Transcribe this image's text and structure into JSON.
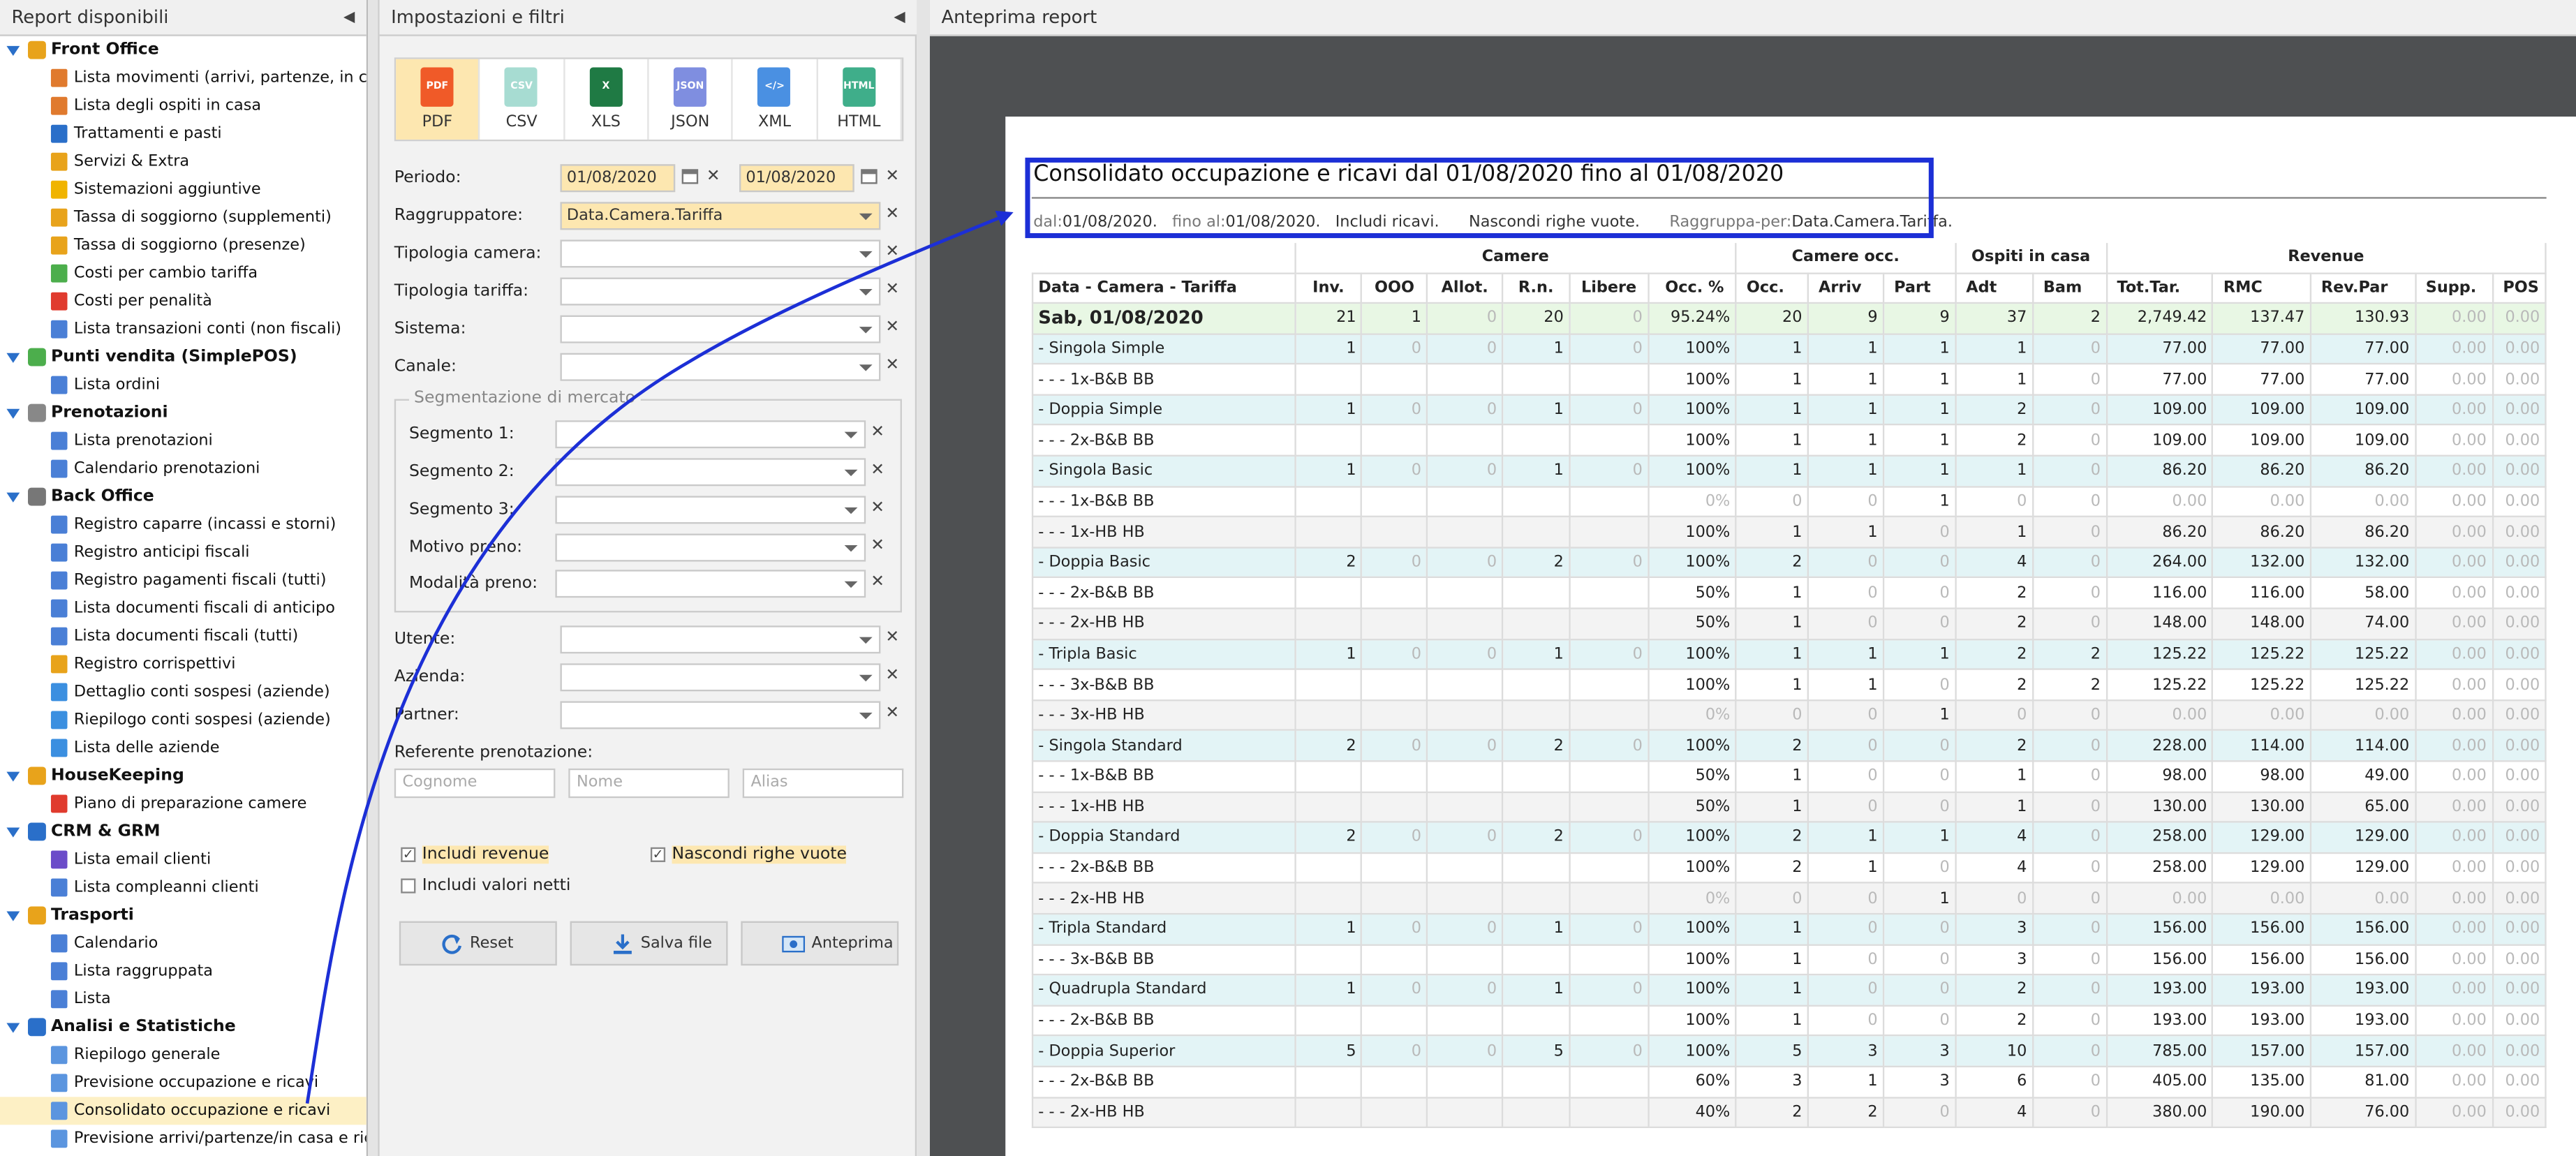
{
  "left_panel": {
    "title": "Report disponibili",
    "groups": [
      {
        "label": "Front Office",
        "icon": "front-office-icon",
        "items": [
          {
            "label": "Lista movimenti (arrivi, partenze, in casa)",
            "icon": "bed-icon"
          },
          {
            "label": "Lista degli ospiti in casa",
            "icon": "bed-icon"
          },
          {
            "label": "Trattamenti e pasti",
            "icon": "cutlery-icon"
          },
          {
            "label": "Servizi & Extra",
            "icon": "services-icon"
          },
          {
            "label": "Sistemazioni aggiuntive",
            "icon": "star-icon"
          },
          {
            "label": "Tassa di soggiorno (supplementi)",
            "icon": "hand-money-icon"
          },
          {
            "label": "Tassa di soggiorno (presenze)",
            "icon": "hand-money-icon"
          },
          {
            "label": "Costi per cambio tariffa",
            "icon": "tag-icon"
          },
          {
            "label": "Costi per penalità",
            "icon": "alert-icon"
          },
          {
            "label": "Lista transazioni conti (non fiscali)",
            "icon": "list-icon"
          }
        ]
      },
      {
        "label": "Punti vendita (SimplePOS)",
        "icon": "store-icon",
        "items": [
          {
            "label": "Lista ordini",
            "icon": "list-icon"
          }
        ]
      },
      {
        "label": "Prenotazioni",
        "icon": "bell-icon",
        "items": [
          {
            "label": "Lista prenotazioni",
            "icon": "list-icon"
          },
          {
            "label": "Calendario prenotazioni",
            "icon": "calendar-icon"
          }
        ]
      },
      {
        "label": "Back Office",
        "icon": "back-office-icon",
        "items": [
          {
            "label": "Registro caparre (incassi e storni)",
            "icon": "list-icon"
          },
          {
            "label": "Registro anticipi fiscali",
            "icon": "list-icon"
          },
          {
            "label": "Registro pagamenti fiscali (tutti)",
            "icon": "list-icon"
          },
          {
            "label": "Lista documenti fiscali di anticipo",
            "icon": "list-icon"
          },
          {
            "label": "Lista documenti fiscali (tutti)",
            "icon": "list-icon"
          },
          {
            "label": "Registro corrispettivi",
            "icon": "hand-money-icon"
          },
          {
            "label": "Dettaglio conti sospesi (aziende)",
            "icon": "building-icon"
          },
          {
            "label": "Riepilogo conti sospesi (aziende)",
            "icon": "building-icon"
          },
          {
            "label": "Lista delle aziende",
            "icon": "building-icon"
          }
        ]
      },
      {
        "label": "HouseKeeping",
        "icon": "broom-icon",
        "items": [
          {
            "label": "Piano di preparazione camere",
            "icon": "door-icon"
          }
        ]
      },
      {
        "label": "CRM & GRM",
        "icon": "crm-icon",
        "items": [
          {
            "label": "Lista email clienti",
            "icon": "email-icon"
          },
          {
            "label": "Lista compleanni clienti",
            "icon": "list-icon"
          }
        ]
      },
      {
        "label": "Trasporti",
        "icon": "car-icon",
        "items": [
          {
            "label": "Calendario",
            "icon": "calendar-icon"
          },
          {
            "label": "Lista raggruppata",
            "icon": "list-icon"
          },
          {
            "label": "Lista",
            "icon": "list-icon"
          }
        ]
      },
      {
        "label": "Analisi e Statistiche",
        "icon": "chart-icon",
        "items": [
          {
            "label": "Riepilogo generale",
            "icon": "document-icon"
          },
          {
            "label": "Previsione occupazione e ricavi",
            "icon": "document-icon"
          },
          {
            "label": "Consolidato occupazione e ricavi",
            "icon": "document-icon",
            "selected": true
          },
          {
            "label": "Previsione arrivi/partenze/in casa e ricavi",
            "icon": "document-icon"
          }
        ]
      }
    ]
  },
  "mid_panel": {
    "title": "Impostazioni e filtri",
    "export": [
      {
        "label": "PDF",
        "icon": "pdf-icon",
        "active": true,
        "badge": "PDF",
        "color": "#f05a28"
      },
      {
        "label": "CSV",
        "icon": "csv-icon",
        "active": false,
        "badge": "CSV",
        "color": "#a7dcd2"
      },
      {
        "label": "XLS",
        "icon": "xls-icon",
        "active": false,
        "badge": "X",
        "color": "#1f7a44"
      },
      {
        "label": "JSON",
        "icon": "json-icon",
        "active": false,
        "badge": "JSON",
        "color": "#7f8ee0"
      },
      {
        "label": "XML",
        "icon": "xml-icon",
        "active": false,
        "badge": "</>",
        "color": "#4a90e2"
      },
      {
        "label": "HTML",
        "icon": "html-icon",
        "active": false,
        "badge": "HTML",
        "color": "#3fae8a"
      }
    ],
    "periodo": {
      "label": "Periodo:",
      "from": "01/08/2020",
      "to": "01/08/2020"
    },
    "raggruppatore": {
      "label": "Raggruppatore:",
      "value": "Data.Camera.Tariffa"
    },
    "tipologia_camera": {
      "label": "Tipologia camera:"
    },
    "tipologia_tariffa": {
      "label": "Tipologia tariffa:"
    },
    "sistema": {
      "label": "Sistema:"
    },
    "canale": {
      "label": "Canale:"
    },
    "segmentazione": {
      "legend": "Segmentazione di mercato",
      "segmento1": "Segmento 1:",
      "segmento2": "Segmento 2:",
      "segmento3": "Segmento 3:",
      "motivo": "Motivo preno:",
      "modalita": "Modalità preno:"
    },
    "utente": {
      "label": "Utente:"
    },
    "azienda": {
      "label": "Azienda:"
    },
    "partner": {
      "label": "Partner:"
    },
    "referente": {
      "label": "Referente prenotazione:",
      "cognome_ph": "Cognome",
      "nome_ph": "Nome",
      "alias_ph": "Alias"
    },
    "includi_revenue": "Includi revenue",
    "nascondi_righe": "Nascondi righe vuote",
    "includi_netti": "Includi valori netti",
    "reset": "Reset",
    "salva": "Salva file",
    "anteprima": "Anteprima"
  },
  "right_panel": {
    "title": "Anteprima report",
    "report": {
      "title": "Consolidato occupazione e ricavi dal 01/08/2020 fino al 01/08/2020",
      "summary": {
        "dal_k": "dal:",
        "dal_v": "01/08/2020.",
        "fino_k": "fino al:",
        "fino_v": "01/08/2020.",
        "includi": "Includi ricavi.",
        "nascondi": "Nascondi righe vuote.",
        "ragg_k": "Raggruppa-per:",
        "ragg_v": "Data.Camera.Tariffa."
      },
      "group_headers": {
        "camere": "Camere",
        "camere_occ": "Camere occ.",
        "ospiti": "Ospiti in casa",
        "revenue": "Revenue"
      },
      "columns": [
        "Data - Camera - Tariffa",
        "Inv.",
        "OOO",
        "Allot.",
        "R.n.",
        "Libere",
        "Occ. %",
        "Occ.",
        "Arriv",
        "Part",
        "Adt",
        "Bam",
        "Tot.Tar.",
        "RMC",
        "Rev.Par",
        "Supp.",
        "POS"
      ],
      "rows": [
        {
          "t": "day",
          "c": [
            "Sab, 01/08/2020",
            "21",
            "1",
            "0",
            "20",
            "0",
            "95.24%",
            "20",
            "9",
            "9",
            "37",
            "2",
            "2,749.42",
            "137.47",
            "130.93",
            "0.00",
            "0.00"
          ]
        },
        {
          "t": "room",
          "c": [
            "- Singola Simple",
            "1",
            "0",
            "0",
            "1",
            "0",
            "100%",
            "1",
            "1",
            "1",
            "1",
            "0",
            "77.00",
            "77.00",
            "77.00",
            "0.00",
            "0.00"
          ]
        },
        {
          "t": "sub",
          "c": [
            "- - - 1x-B&B BB",
            "",
            "",
            "",
            "",
            "",
            "100%",
            "1",
            "1",
            "1",
            "1",
            "0",
            "77.00",
            "77.00",
            "77.00",
            "0.00",
            "0.00"
          ]
        },
        {
          "t": "room",
          "c": [
            "- Doppia Simple",
            "1",
            "0",
            "0",
            "1",
            "0",
            "100%",
            "1",
            "1",
            "1",
            "2",
            "0",
            "109.00",
            "109.00",
            "109.00",
            "0.00",
            "0.00"
          ]
        },
        {
          "t": "sub",
          "c": [
            "- - - 2x-B&B BB",
            "",
            "",
            "",
            "",
            "",
            "100%",
            "1",
            "1",
            "1",
            "2",
            "0",
            "109.00",
            "109.00",
            "109.00",
            "0.00",
            "0.00"
          ]
        },
        {
          "t": "room",
          "c": [
            "- Singola Basic",
            "1",
            "0",
            "0",
            "1",
            "0",
            "100%",
            "1",
            "1",
            "1",
            "1",
            "0",
            "86.20",
            "86.20",
            "86.20",
            "0.00",
            "0.00"
          ]
        },
        {
          "t": "sub",
          "c": [
            "- - - 1x-B&B BB",
            "",
            "",
            "",
            "",
            "",
            "0%",
            "0",
            "0",
            "1",
            "0",
            "0",
            "0.00",
            "0.00",
            "0.00",
            "0.00",
            "0.00"
          ]
        },
        {
          "t": "sub",
          "c": [
            "- - - 1x-HB HB",
            "",
            "",
            "",
            "",
            "",
            "100%",
            "1",
            "1",
            "0",
            "1",
            "0",
            "86.20",
            "86.20",
            "86.20",
            "0.00",
            "0.00"
          ]
        },
        {
          "t": "room",
          "c": [
            "- Doppia Basic",
            "2",
            "0",
            "0",
            "2",
            "0",
            "100%",
            "2",
            "0",
            "0",
            "4",
            "0",
            "264.00",
            "132.00",
            "132.00",
            "0.00",
            "0.00"
          ]
        },
        {
          "t": "sub",
          "c": [
            "- - - 2x-B&B BB",
            "",
            "",
            "",
            "",
            "",
            "50%",
            "1",
            "0",
            "0",
            "2",
            "0",
            "116.00",
            "116.00",
            "58.00",
            "0.00",
            "0.00"
          ]
        },
        {
          "t": "sub",
          "c": [
            "- - - 2x-HB HB",
            "",
            "",
            "",
            "",
            "",
            "50%",
            "1",
            "0",
            "0",
            "2",
            "0",
            "148.00",
            "148.00",
            "74.00",
            "0.00",
            "0.00"
          ]
        },
        {
          "t": "room",
          "c": [
            "- Tripla Basic",
            "1",
            "0",
            "0",
            "1",
            "0",
            "100%",
            "1",
            "1",
            "1",
            "2",
            "2",
            "125.22",
            "125.22",
            "125.22",
            "0.00",
            "0.00"
          ]
        },
        {
          "t": "sub",
          "c": [
            "- - - 3x-B&B BB",
            "",
            "",
            "",
            "",
            "",
            "100%",
            "1",
            "1",
            "0",
            "2",
            "2",
            "125.22",
            "125.22",
            "125.22",
            "0.00",
            "0.00"
          ]
        },
        {
          "t": "sub",
          "c": [
            "- - - 3x-HB HB",
            "",
            "",
            "",
            "",
            "",
            "0%",
            "0",
            "0",
            "1",
            "0",
            "0",
            "0.00",
            "0.00",
            "0.00",
            "0.00",
            "0.00"
          ]
        },
        {
          "t": "room",
          "c": [
            "- Singola Standard",
            "2",
            "0",
            "0",
            "2",
            "0",
            "100%",
            "2",
            "0",
            "0",
            "2",
            "0",
            "228.00",
            "114.00",
            "114.00",
            "0.00",
            "0.00"
          ]
        },
        {
          "t": "sub",
          "c": [
            "- - - 1x-B&B BB",
            "",
            "",
            "",
            "",
            "",
            "50%",
            "1",
            "0",
            "0",
            "1",
            "0",
            "98.00",
            "98.00",
            "49.00",
            "0.00",
            "0.00"
          ]
        },
        {
          "t": "sub",
          "c": [
            "- - - 1x-HB HB",
            "",
            "",
            "",
            "",
            "",
            "50%",
            "1",
            "0",
            "0",
            "1",
            "0",
            "130.00",
            "130.00",
            "65.00",
            "0.00",
            "0.00"
          ]
        },
        {
          "t": "room",
          "c": [
            "- Doppia Standard",
            "2",
            "0",
            "0",
            "2",
            "0",
            "100%",
            "2",
            "1",
            "1",
            "4",
            "0",
            "258.00",
            "129.00",
            "129.00",
            "0.00",
            "0.00"
          ]
        },
        {
          "t": "sub",
          "c": [
            "- - - 2x-B&B BB",
            "",
            "",
            "",
            "",
            "",
            "100%",
            "2",
            "1",
            "0",
            "4",
            "0",
            "258.00",
            "129.00",
            "129.00",
            "0.00",
            "0.00"
          ]
        },
        {
          "t": "sub",
          "c": [
            "- - - 2x-HB HB",
            "",
            "",
            "",
            "",
            "",
            "0%",
            "0",
            "0",
            "1",
            "0",
            "0",
            "0.00",
            "0.00",
            "0.00",
            "0.00",
            "0.00"
          ]
        },
        {
          "t": "room",
          "c": [
            "- Tripla Standard",
            "1",
            "0",
            "0",
            "1",
            "0",
            "100%",
            "1",
            "0",
            "0",
            "3",
            "0",
            "156.00",
            "156.00",
            "156.00",
            "0.00",
            "0.00"
          ]
        },
        {
          "t": "sub",
          "c": [
            "- - - 3x-B&B BB",
            "",
            "",
            "",
            "",
            "",
            "100%",
            "1",
            "0",
            "0",
            "3",
            "0",
            "156.00",
            "156.00",
            "156.00",
            "0.00",
            "0.00"
          ]
        },
        {
          "t": "room",
          "c": [
            "- Quadrupla Standard",
            "1",
            "0",
            "0",
            "1",
            "0",
            "100%",
            "1",
            "0",
            "0",
            "2",
            "0",
            "193.00",
            "193.00",
            "193.00",
            "0.00",
            "0.00"
          ]
        },
        {
          "t": "sub",
          "c": [
            "- - - 2x-B&B BB",
            "",
            "",
            "",
            "",
            "",
            "100%",
            "1",
            "0",
            "0",
            "2",
            "0",
            "193.00",
            "193.00",
            "193.00",
            "0.00",
            "0.00"
          ]
        },
        {
          "t": "room",
          "c": [
            "- Doppia Superior",
            "5",
            "0",
            "0",
            "5",
            "0",
            "100%",
            "5",
            "3",
            "3",
            "10",
            "0",
            "785.00",
            "157.00",
            "157.00",
            "0.00",
            "0.00"
          ]
        },
        {
          "t": "sub",
          "c": [
            "- - - 2x-B&B BB",
            "",
            "",
            "",
            "",
            "",
            "60%",
            "3",
            "1",
            "3",
            "6",
            "0",
            "405.00",
            "135.00",
            "81.00",
            "0.00",
            "0.00"
          ]
        },
        {
          "t": "sub",
          "c": [
            "- - - 2x-HB HB",
            "",
            "",
            "",
            "",
            "",
            "40%",
            "2",
            "2",
            "0",
            "4",
            "0",
            "380.00",
            "190.00",
            "76.00",
            "0.00",
            "0.00"
          ]
        }
      ]
    }
  },
  "colors": {
    "accent": "#2a6fc9",
    "highlight": "#1c2fd6",
    "selected": "#fde7b0"
  }
}
